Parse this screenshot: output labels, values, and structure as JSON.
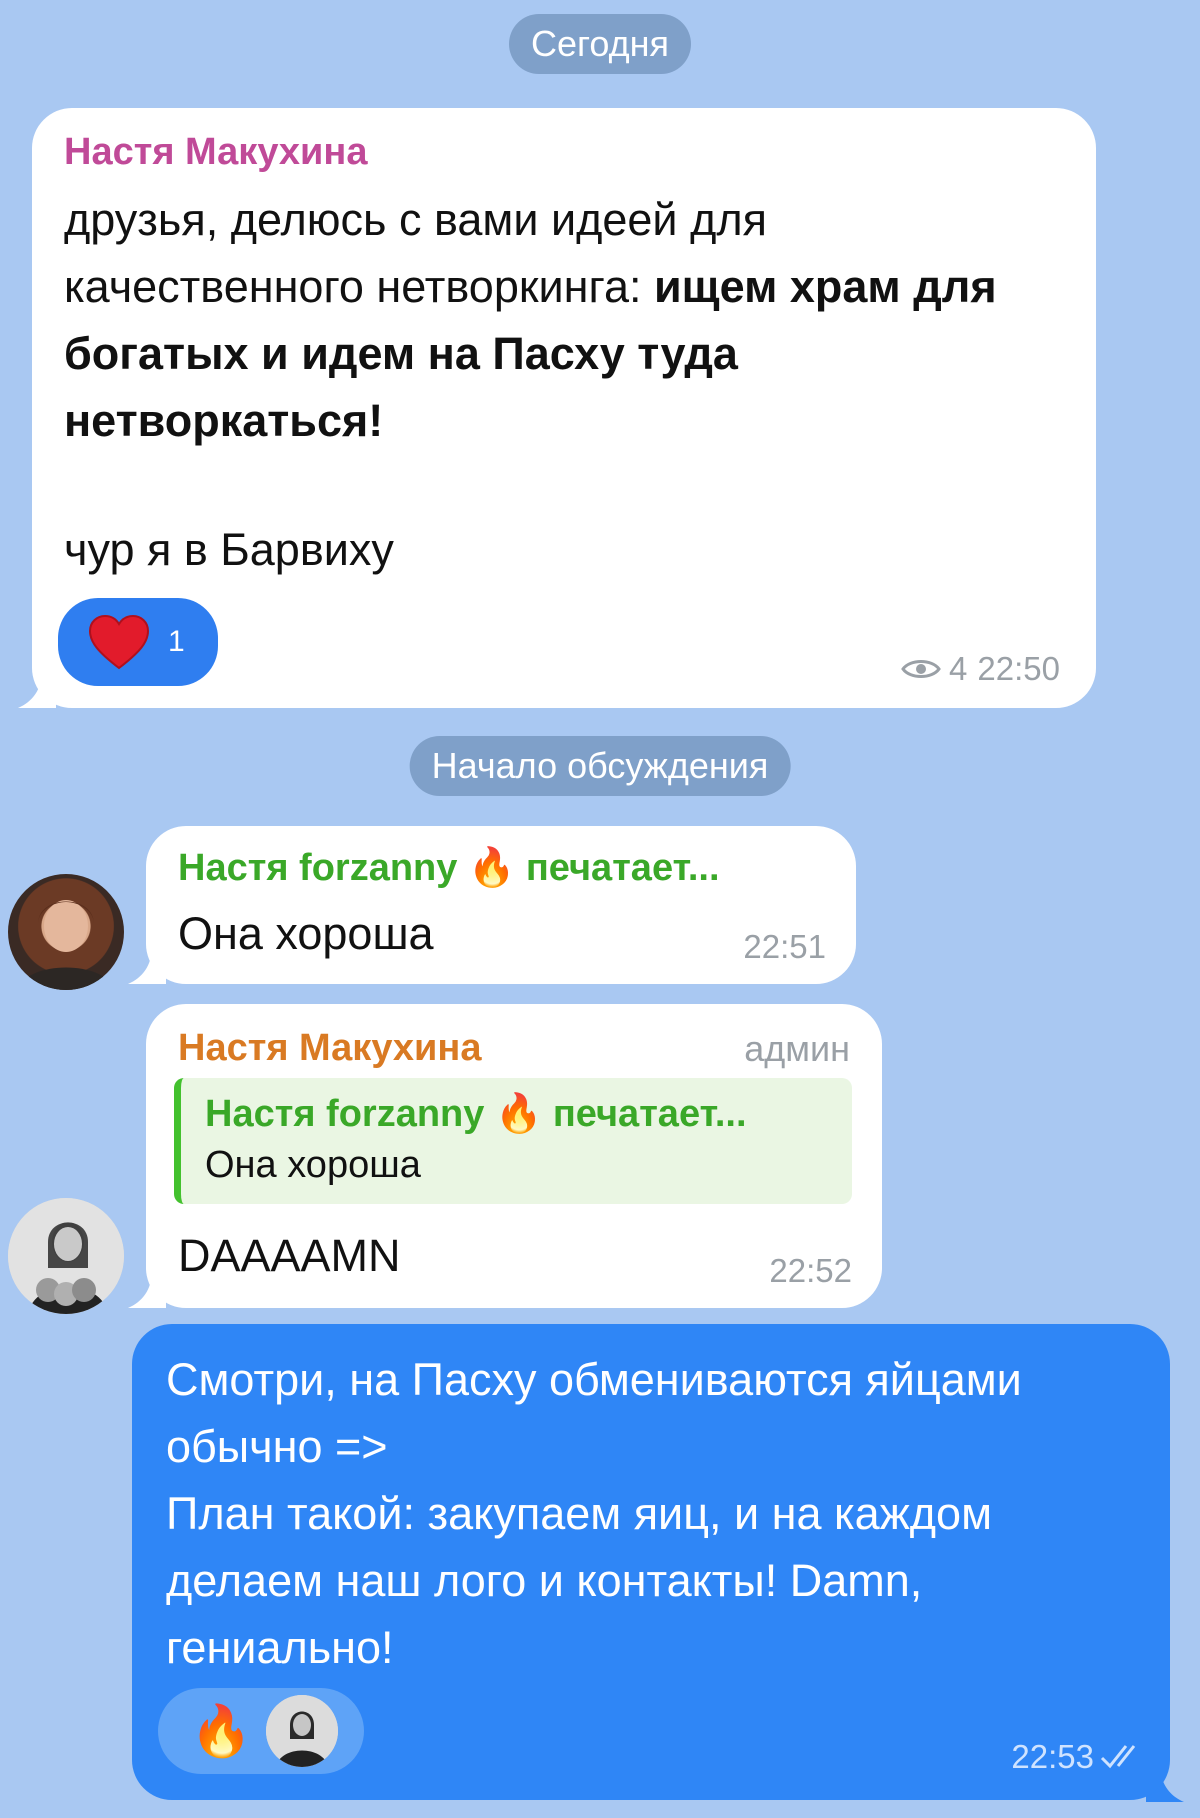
{
  "date_divider": "Сегодня",
  "discussion_divider": "Начало обсуждения",
  "post": {
    "author": "Настя Макухина",
    "text_plain_1": "друзья, делюсь с вами идеей для качественного нетворкинга: ",
    "text_bold": "ищем храм для богатых и идем на Пасху туда нетворкаться!",
    "text_plain_2": "чур я в Барвиху",
    "reaction": {
      "icon": "heart-icon",
      "count": "1"
    },
    "views": "4",
    "time": "22:50",
    "author_color": "#c04a98"
  },
  "comments": [
    {
      "author": "Настя forzanny",
      "author_suffix": "печатает...",
      "text": "Она хороша",
      "time": "22:51",
      "author_color": "#3aa828"
    },
    {
      "author": "Настя Макухина",
      "badge": "админ",
      "quote_author": "Настя forzanny",
      "quote_suffix": "печатает...",
      "quote_text": "Она хороша",
      "text": "DAAAAMN",
      "time": "22:52",
      "author_color": "#d97a23"
    }
  ],
  "outgoing": {
    "text_1": "Смотри, на Пасху обмениваются яйцами обычно =>",
    "text_2": "План такой: закупаем яиц, и на каждом делаем наш лого и контакты! Damn, гениально!",
    "reactions": [
      "fire-icon",
      "avatar"
    ],
    "time": "22:53",
    "status": "double-check-icon"
  }
}
